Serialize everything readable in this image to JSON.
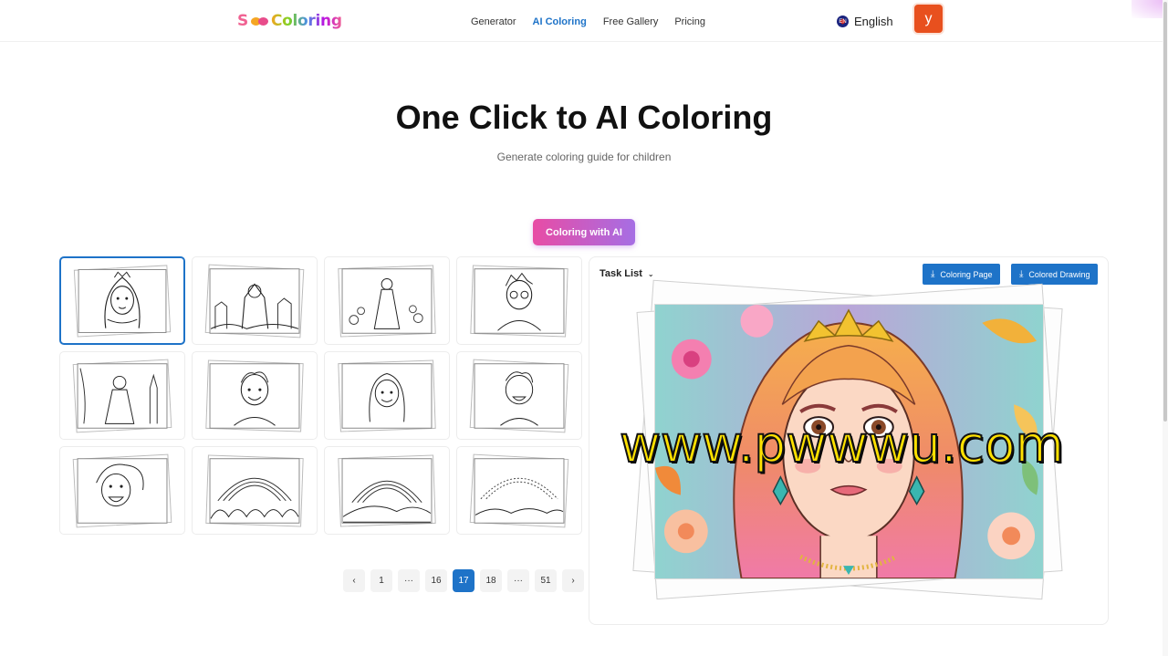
{
  "header": {
    "logo_letter": "S",
    "logo_rest": "Coloring",
    "nav": [
      {
        "label": "Generator",
        "active": false
      },
      {
        "label": "AI Coloring",
        "active": true
      },
      {
        "label": "Free Gallery",
        "active": false
      },
      {
        "label": "Pricing",
        "active": false
      }
    ],
    "language": {
      "flag_code": "EN",
      "label": "English"
    },
    "avatar_letter": "y",
    "accent_color": "#1e73c8"
  },
  "hero": {
    "title": "One Click to AI Coloring",
    "subtitle": "Generate coloring guide for children",
    "cta_label": "Coloring with AI"
  },
  "gallery": {
    "items": [
      {
        "subject": "princess-portrait",
        "selected": true
      },
      {
        "subject": "knight-castle",
        "selected": false
      },
      {
        "subject": "princess-garden",
        "selected": false
      },
      {
        "subject": "boy-glasses",
        "selected": false
      },
      {
        "subject": "princess-tower",
        "selected": false
      },
      {
        "subject": "smiling-boy",
        "selected": false
      },
      {
        "subject": "smiling-girl",
        "selected": false
      },
      {
        "subject": "laughing-boy",
        "selected": false
      },
      {
        "subject": "laughing-girl",
        "selected": false
      },
      {
        "subject": "rainbow-flowers",
        "selected": false
      },
      {
        "subject": "rainbow-hills",
        "selected": false
      },
      {
        "subject": "rainbow-field",
        "selected": false
      }
    ]
  },
  "pagination": {
    "prev_icon": "chevron-left-icon",
    "next_icon": "chevron-right-icon",
    "pages": [
      "1",
      "···",
      "16",
      "17",
      "18",
      "···",
      "51"
    ],
    "current": "17"
  },
  "panel": {
    "task_list_label": "Task List",
    "task_list_icon": "chevron-down-icon",
    "buttons": [
      {
        "label": "Coloring Page",
        "icon": "download-icon"
      },
      {
        "label": "Colored Drawing",
        "icon": "download-icon"
      }
    ],
    "preview_subject": "colored-princess-portrait"
  },
  "watermark": "www.pwwwu.com"
}
